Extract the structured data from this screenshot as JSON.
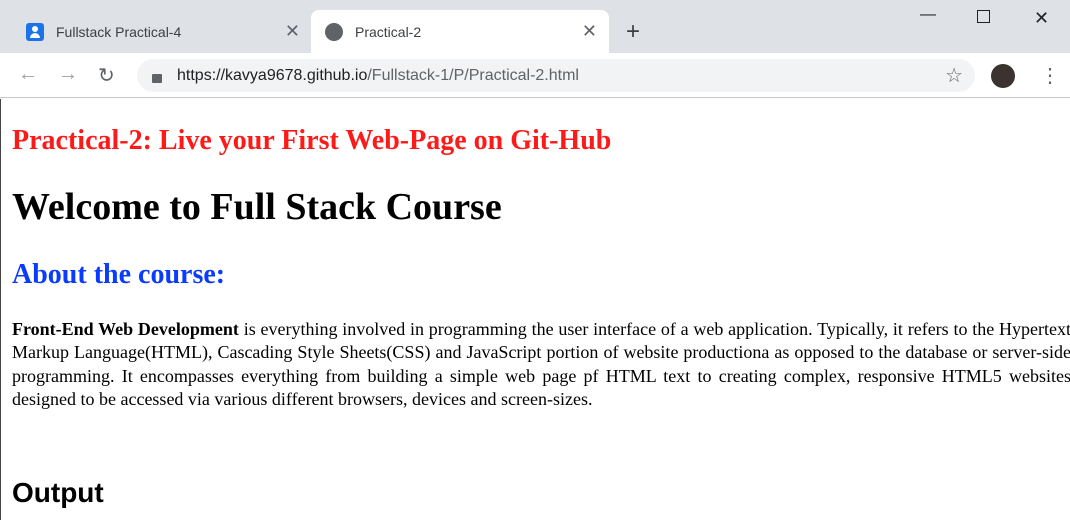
{
  "browser": {
    "tabs": [
      {
        "title": "Fullstack Practical-4",
        "icon": "contact-icon",
        "active": false
      },
      {
        "title": "Practical-2",
        "icon": "globe-icon",
        "active": true
      }
    ],
    "url_host": "https://kavya9678.github.io",
    "url_path": "/Fullstack-1/P/Practical-2.html"
  },
  "page": {
    "practical_title": "Practical-2: Live your First Web-Page on Git-Hub",
    "welcome": "Welcome to Full Stack Course",
    "about": "About the course:",
    "desc_bold": "Front-End Web Development",
    "desc_rest": " is everything involved in programming the user interface of a web application. Typically, it refers to the Hypertext Markup Language(HTML), Cascading Style Sheets(CSS) and JavaScript portion of website productiona as opposed to the database or server-side programming. It encompasses everything from building a simple web page pf HTML text to creating complex, responsive HTML5 websites designed to be accessed via various different browsers, devices and screen-sizes.",
    "output_heading": "Output"
  },
  "colors": {
    "title_red": "#ff1a1a",
    "about_blue": "#0a3cff"
  }
}
